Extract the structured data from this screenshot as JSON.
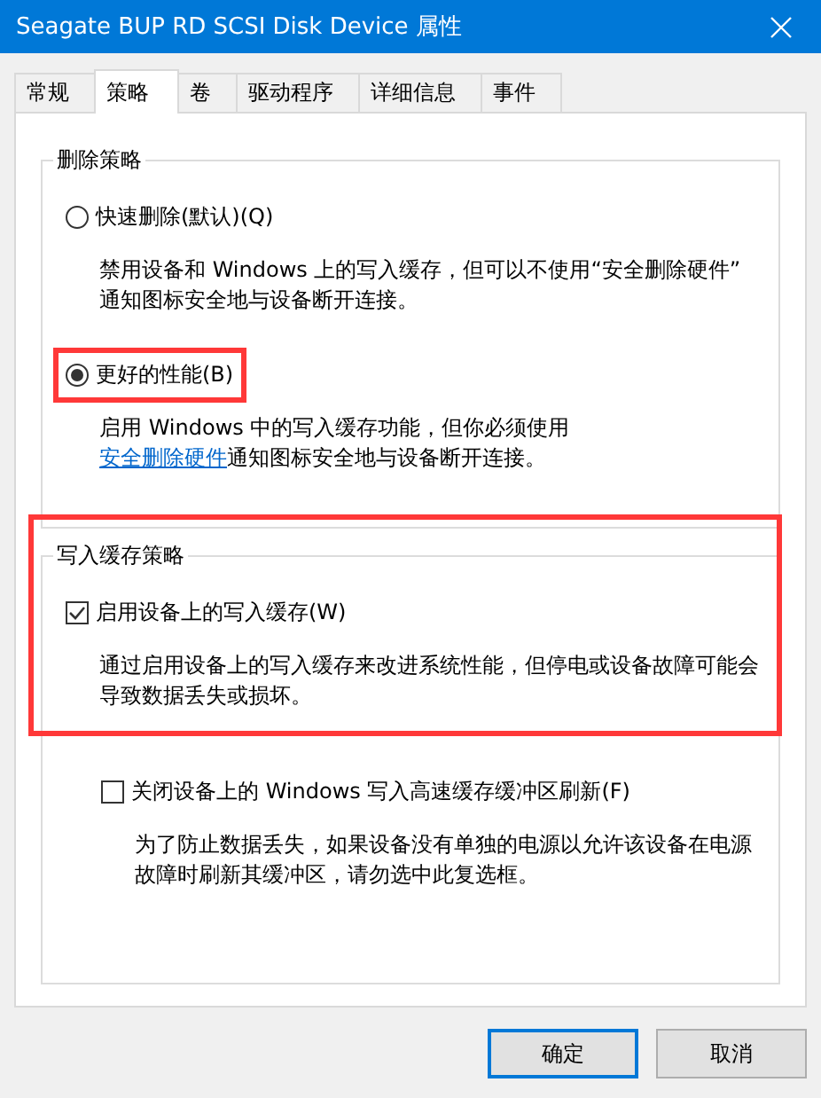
{
  "window": {
    "title": "Seagate BUP RD SCSI Disk Device 属性"
  },
  "tabs": [
    {
      "label": "常规",
      "selected": false
    },
    {
      "label": "策略",
      "selected": true
    },
    {
      "label": "卷",
      "selected": false
    },
    {
      "label": "驱动程序",
      "selected": false
    },
    {
      "label": "详细信息",
      "selected": false
    },
    {
      "label": "事件",
      "selected": false
    }
  ],
  "groups": [
    {
      "title": "删除策略",
      "highlighted": false,
      "options": [
        {
          "kind": "radio",
          "label": "快速删除(默认)(Q)",
          "selected": false,
          "highlighted": false,
          "lines": [
            [
              {
                "kind": "text",
                "text": "禁用设备和 Windows 上的写入缓存，但可以不使用“安全删除硬件”"
              }
            ],
            [
              {
                "kind": "text",
                "text": "通知图标安全地与设备断开连接。"
              }
            ]
          ]
        },
        {
          "kind": "radio",
          "label": "更好的性能(B)",
          "selected": true,
          "highlighted": true,
          "lines": [
            [
              {
                "kind": "text",
                "text": "启用 Windows 中的写入缓存功能，但你必须使用"
              }
            ],
            [
              {
                "kind": "link",
                "text": "安全删除硬件"
              },
              {
                "kind": "text",
                "text": "通知图标安全地与设备断开连接。"
              }
            ]
          ]
        }
      ]
    },
    {
      "title": "写入缓存策略",
      "highlighted": true,
      "options": [
        {
          "kind": "checkbox",
          "label": "启用设备上的写入缓存(W)",
          "checked": true,
          "highlighted": false,
          "lines": [
            [
              {
                "kind": "text",
                "text": "通过启用设备上的写入缓存来改进系统性能，但停电或设备故障可能会"
              }
            ],
            [
              {
                "kind": "text",
                "text": "导致数据丢失或损坏。"
              }
            ]
          ],
          "children": [
            {
              "kind": "checkbox",
              "label": "关闭设备上的 Windows 写入高速缓存缓冲区刷新(F)",
              "checked": false,
              "highlighted": false,
              "lines": [
                [
                  {
                    "kind": "text",
                    "text": "为了防止数据丢失，如果设备没有单独的电源以允许该设备在电源"
                  }
                ],
                [
                  {
                    "kind": "text",
                    "text": "故障时刷新其缓冲区，请勿选中此复选框。"
                  }
                ]
              ]
            }
          ]
        }
      ]
    }
  ],
  "buttons": [
    {
      "label": "确定",
      "default": true
    },
    {
      "label": "取消",
      "default": false
    }
  ]
}
